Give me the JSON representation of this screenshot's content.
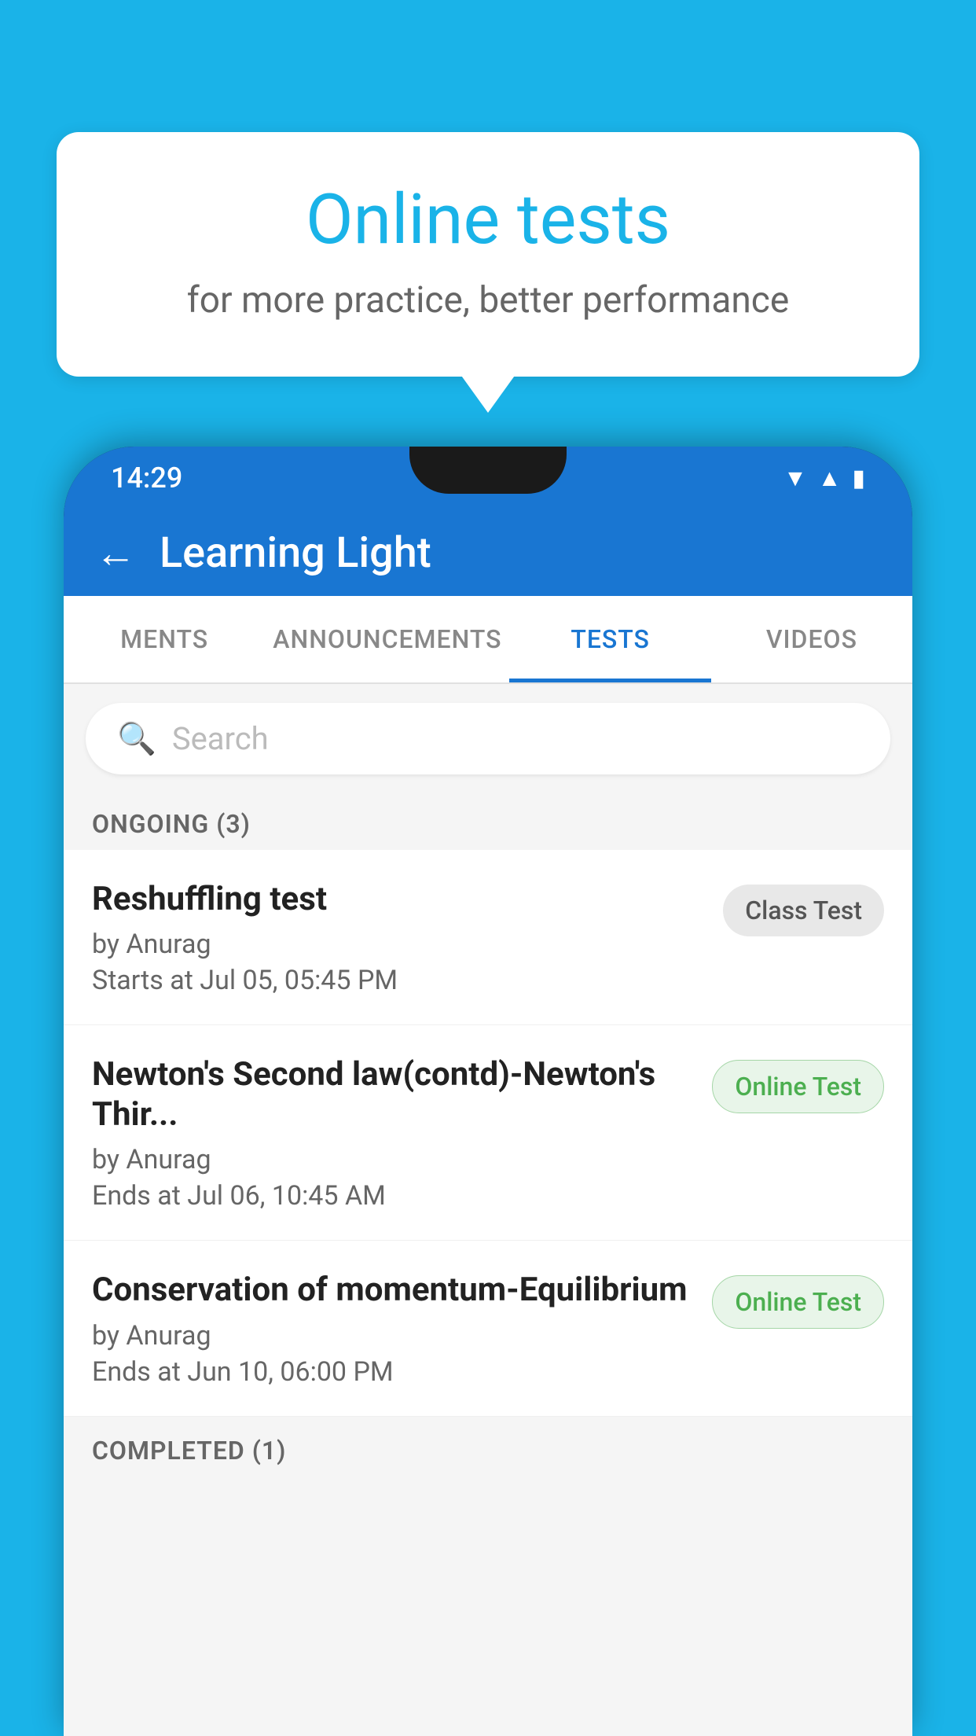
{
  "background": {
    "color": "#1ab3e8"
  },
  "bubble": {
    "title": "Online tests",
    "subtitle": "for more practice, better performance"
  },
  "phone": {
    "statusBar": {
      "time": "14:29",
      "icons": [
        "wifi",
        "signal",
        "battery"
      ]
    },
    "header": {
      "back_label": "←",
      "title": "Learning Light"
    },
    "tabs": [
      {
        "label": "MENTS",
        "active": false
      },
      {
        "label": "ANNOUNCEMENTS",
        "active": false
      },
      {
        "label": "TESTS",
        "active": true
      },
      {
        "label": "VIDEOS",
        "active": false
      }
    ],
    "search": {
      "placeholder": "Search"
    },
    "sections": [
      {
        "header": "ONGOING (3)",
        "items": [
          {
            "name": "Reshuffling test",
            "by": "by Anurag",
            "time": "Starts at  Jul 05, 05:45 PM",
            "badge": "Class Test",
            "badge_type": "class"
          },
          {
            "name": "Newton's Second law(contd)-Newton's Thir...",
            "by": "by Anurag",
            "time": "Ends at  Jul 06, 10:45 AM",
            "badge": "Online Test",
            "badge_type": "online"
          },
          {
            "name": "Conservation of momentum-Equilibrium",
            "by": "by Anurag",
            "time": "Ends at  Jun 10, 06:00 PM",
            "badge": "Online Test",
            "badge_type": "online"
          }
        ]
      }
    ],
    "completed_header": "COMPLETED (1)"
  }
}
